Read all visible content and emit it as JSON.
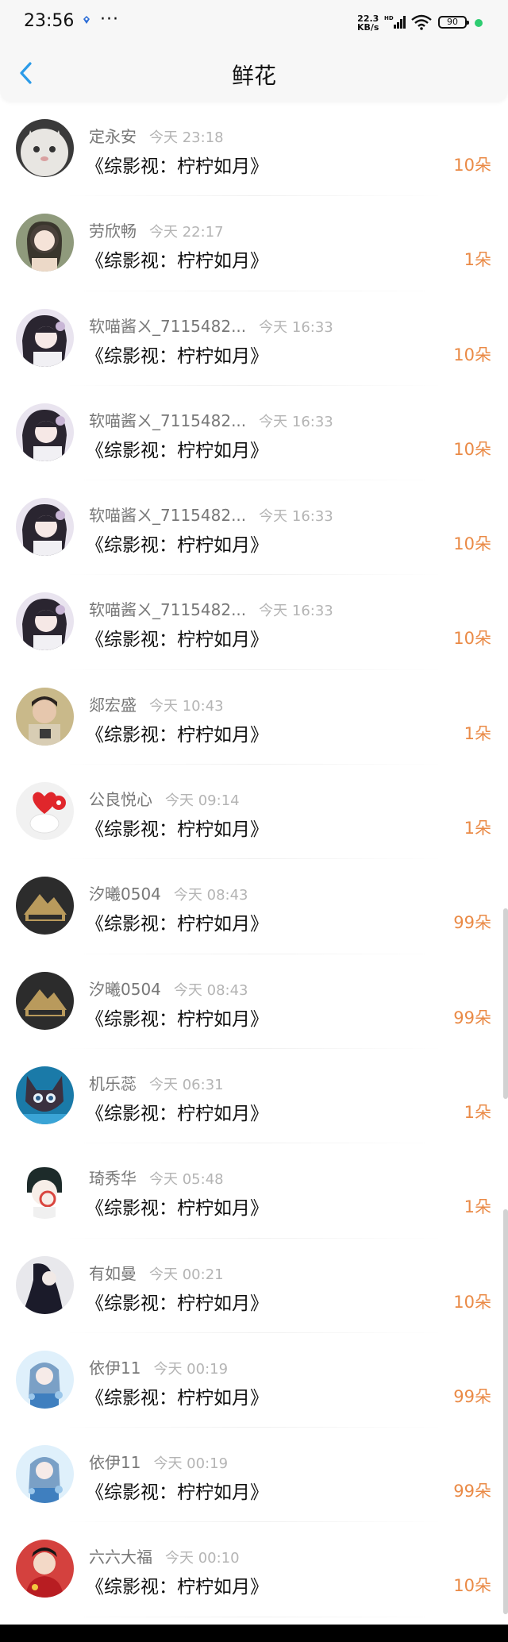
{
  "status_bar": {
    "time": "23:56",
    "dots": "···",
    "speed_line1": "22.3",
    "speed_line2": "KB/s",
    "network": "HD",
    "battery": "90"
  },
  "header": {
    "back_icon": "chevron-left-icon",
    "title": "鲜花"
  },
  "colors": {
    "accent_blue": "#2b9be8",
    "count_orange": "#ea8a46"
  },
  "rows": [
    {
      "name": "定永安",
      "time": "今天 23:18",
      "book": "《综影视：柠柠如月》",
      "count": "10朵",
      "avatar": "white-cat"
    },
    {
      "name": "劳欣畅",
      "time": "今天 22:17",
      "book": "《综影视：柠柠如月》",
      "count": "1朵",
      "avatar": "girl-portrait"
    },
    {
      "name": "软喵酱ㄨ_7115482...",
      "time": "今天 16:33",
      "book": "《综影视：柠柠如月》",
      "count": "10朵",
      "avatar": "anime-girl"
    },
    {
      "name": "软喵酱ㄨ_7115482...",
      "time": "今天 16:33",
      "book": "《综影视：柠柠如月》",
      "count": "10朵",
      "avatar": "anime-girl"
    },
    {
      "name": "软喵酱ㄨ_7115482...",
      "time": "今天 16:33",
      "book": "《综影视：柠柠如月》",
      "count": "10朵",
      "avatar": "anime-girl"
    },
    {
      "name": "软喵酱ㄨ_7115482...",
      "time": "今天 16:33",
      "book": "《综影视：柠柠如月》",
      "count": "10朵",
      "avatar": "anime-girl"
    },
    {
      "name": "郯宏盛",
      "time": "今天 10:43",
      "book": "《综影视：柠柠如月》",
      "count": "1朵",
      "avatar": "man-portrait"
    },
    {
      "name": "公良悦心",
      "time": "今天 09:14",
      "book": "《综影视：柠柠如月》",
      "count": "1朵",
      "avatar": "red-heart"
    },
    {
      "name": "汐曦0504",
      "time": "今天 08:43",
      "book": "《综影视：柠柠如月》",
      "count": "99朵",
      "avatar": "dark-logo"
    },
    {
      "name": "汐曦0504",
      "time": "今天 08:43",
      "book": "《综影视：柠柠如月》",
      "count": "99朵",
      "avatar": "dark-logo"
    },
    {
      "name": "机乐蕊",
      "time": "今天 06:31",
      "book": "《综影视：柠柠如月》",
      "count": "1朵",
      "avatar": "cat-drawing"
    },
    {
      "name": "琦秀华",
      "time": "今天 05:48",
      "book": "《综影视：柠柠如月》",
      "count": "1朵",
      "avatar": "cartoon-boy"
    },
    {
      "name": "有如曼",
      "time": "今天 00:21",
      "book": "《综影视：柠柠如月》",
      "count": "10朵",
      "avatar": "dark-figure"
    },
    {
      "name": "依伊11",
      "time": "今天 00:19",
      "book": "《综影视：柠柠如月》",
      "count": "99朵",
      "avatar": "blue-girl"
    },
    {
      "name": "依伊11",
      "time": "今天 00:19",
      "book": "《综影视：柠柠如月》",
      "count": "99朵",
      "avatar": "blue-girl"
    },
    {
      "name": "六六大福",
      "time": "今天 00:10",
      "book": "《综影视：柠柠如月》",
      "count": "10朵",
      "avatar": "red-sweater"
    }
  ]
}
